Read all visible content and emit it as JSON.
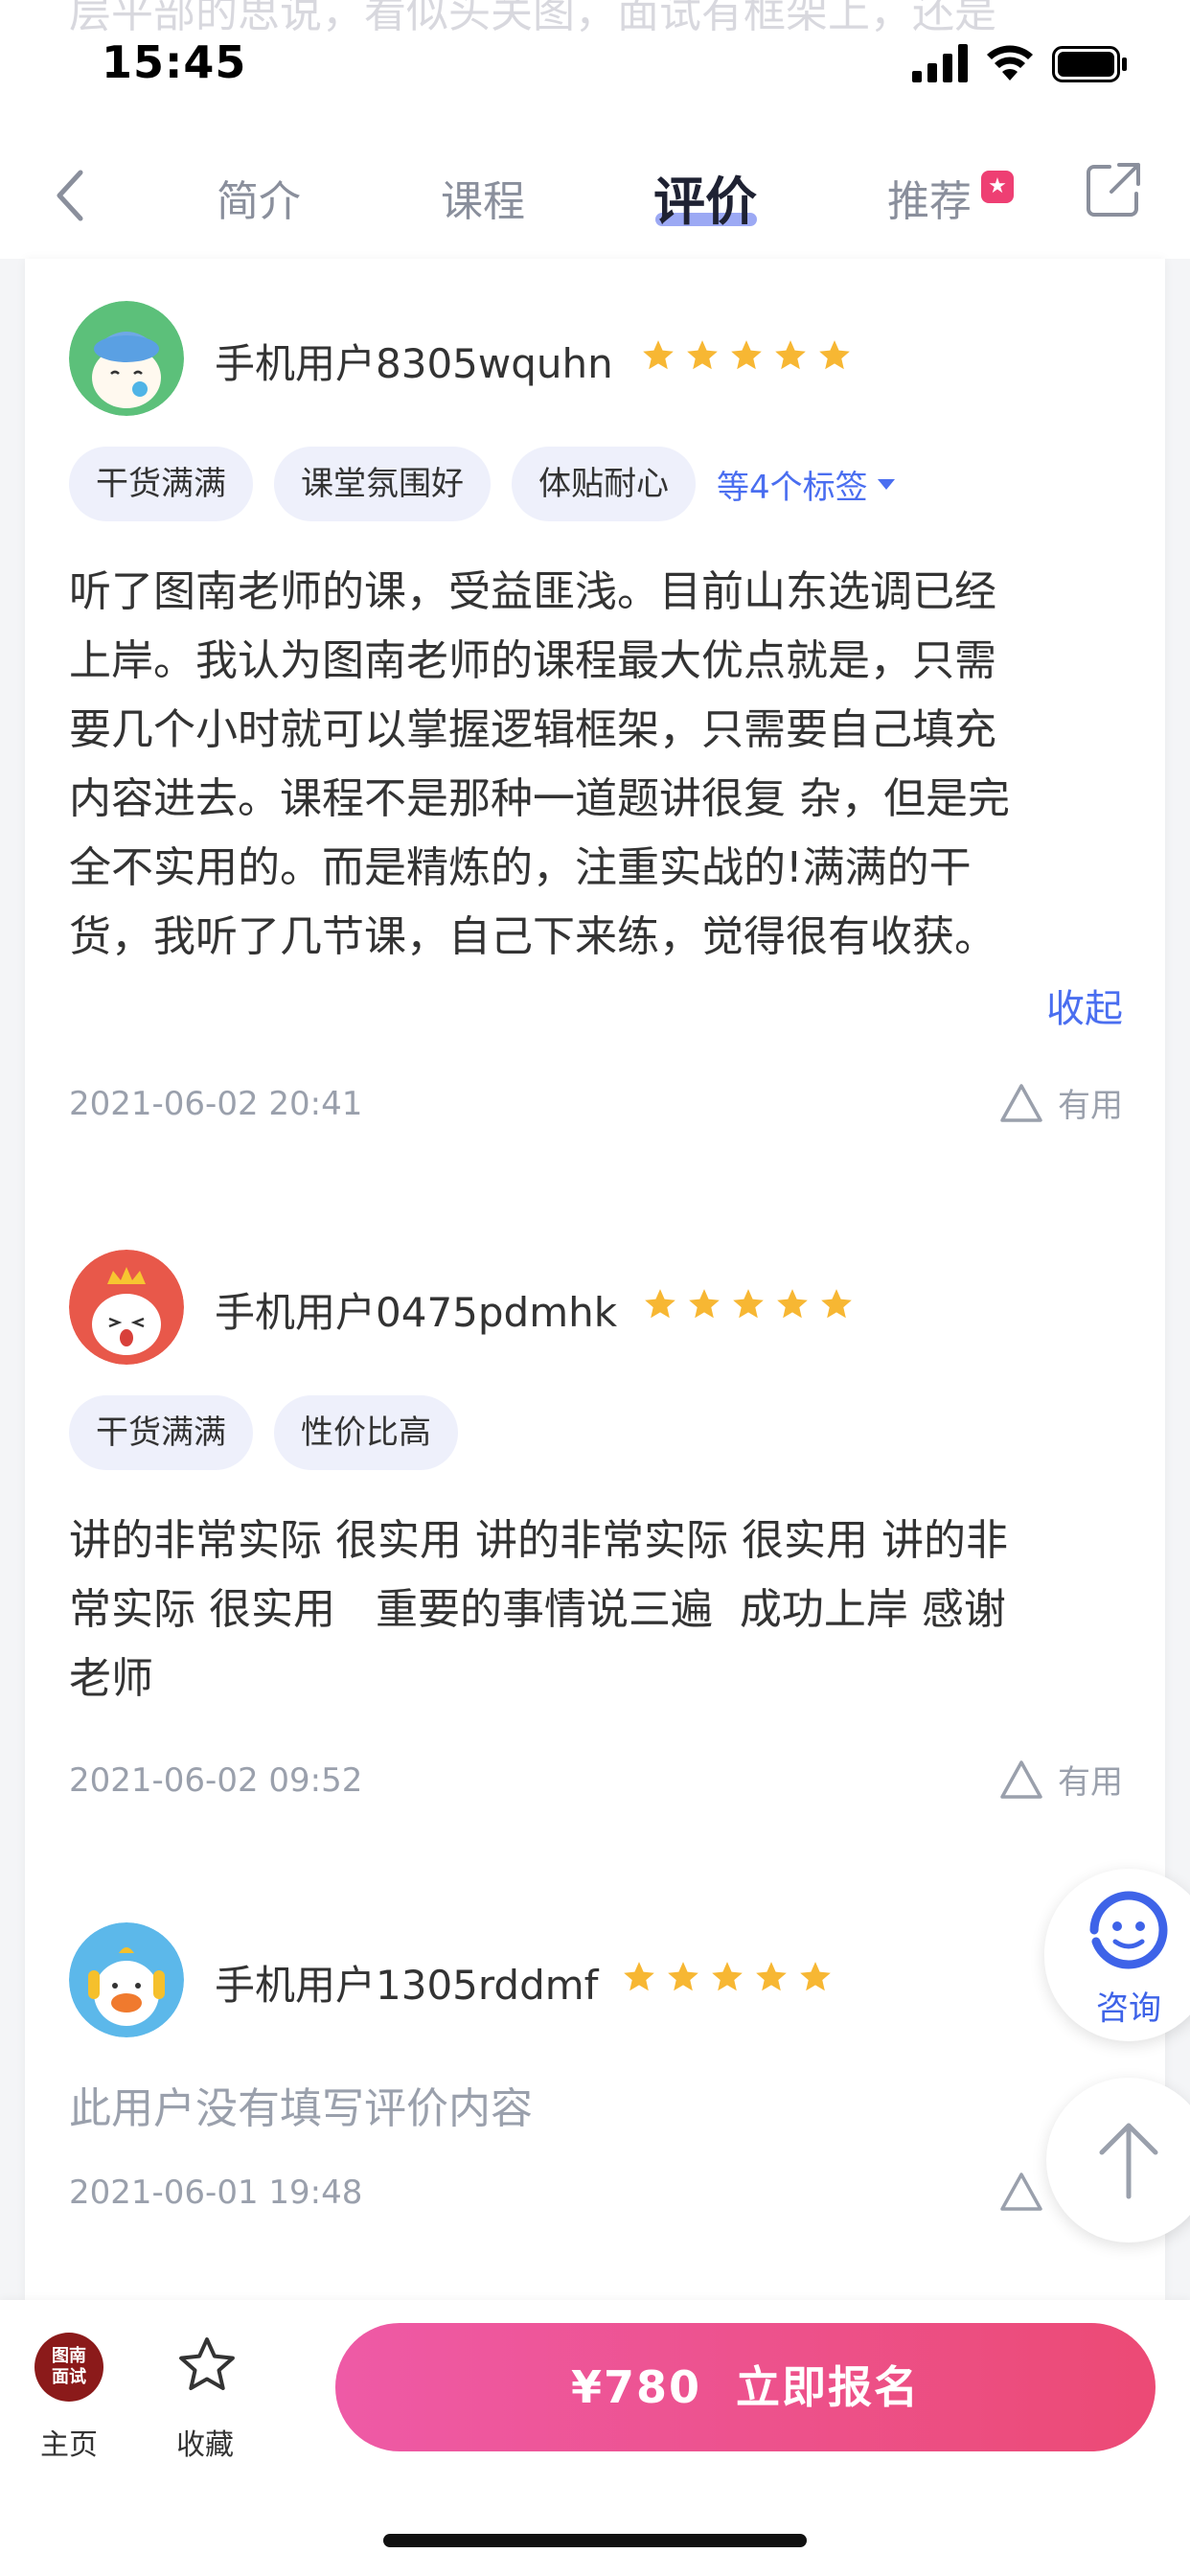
{
  "status_bar": {
    "time": "15:45"
  },
  "nav": {
    "tabs": [
      {
        "label": "简介"
      },
      {
        "label": "课程"
      },
      {
        "label": "评价"
      },
      {
        "label": "推荐"
      }
    ]
  },
  "reviews": [
    {
      "username": "手机用户8305wquhn",
      "rating": 5,
      "tags": [
        "干货满满",
        "课堂氛围好",
        "体贴耐心"
      ],
      "more_tags": "等4个标签",
      "lines": [
        "听了图南老师的课，受益匪浅。目前山东选调已经",
        "上岸。我认为图南老师的课程最大优点就是，只需",
        "要几个小时就可以掌握逻辑框架，只需要自己填充",
        "内容进去。课程不是那种一道题讲很复 杂，但是完",
        "全不实用的。而是精炼的，注重实战的!满满的干",
        "货，我听了几节课，自己下来练，觉得很有收获。"
      ],
      "collapse_label": "收起",
      "date": "2021-06-02 20:41",
      "useful_label": "有用"
    },
    {
      "username": "手机用户0475pdmhk",
      "rating": 5,
      "tags": [
        "干货满满",
        "性价比高"
      ],
      "lines": [
        "讲的非常实际 很实用 讲的非常实际 很实用 讲的非",
        "常实际 很实用   重要的事情说三遍  成功上岸 感谢",
        "老师"
      ],
      "date": "2021-06-02 09:52",
      "useful_label": "有用"
    },
    {
      "username": "手机用户1305rddmf",
      "rating": 5,
      "empty_text": "此用户没有填写评价内容",
      "date": "2021-06-01 19:48",
      "useful_label": "有用"
    }
  ],
  "floating": {
    "consult_label": "咨询"
  },
  "bottom_bar": {
    "home_logo_line1": "图南",
    "home_logo_line2": "面试",
    "home_label": "主页",
    "favorite_label": "收藏",
    "enroll_label": "¥780  立即报名"
  },
  "colors": {
    "accent_blue": "#4a6ef0",
    "star": "#f7b733",
    "enroll_gradient_start": "#ee5aa6",
    "enroll_gradient_end": "#ec4a75",
    "tag_bg": "#eef0fb"
  }
}
